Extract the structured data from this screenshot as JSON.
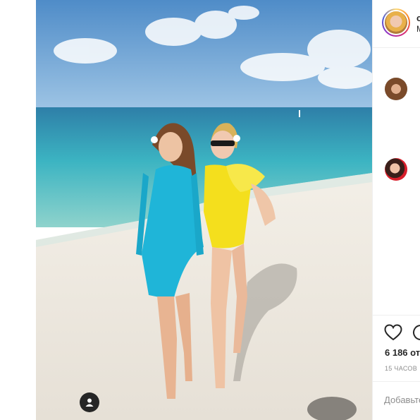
{
  "post": {
    "photo_alt": "",
    "user_tag_icon": "person-icon"
  },
  "header": {
    "username": "c",
    "subtitle": "M"
  },
  "actions": {
    "like_icon": "heart-icon",
    "comment_icon": "comment-icon",
    "likes_text": "6 186 от",
    "time_text": "15 ЧАСОВ"
  },
  "comment_box": {
    "placeholder": "Добавьте"
  },
  "colors": {
    "sky": "#6fa4d6",
    "sea": "#3fb7c4",
    "sand": "#ece8e0",
    "dress_blue": "#1fb5d8",
    "swimsuit_yellow": "#f4df1d",
    "border": "#efefef",
    "muted": "#8e8e8e"
  }
}
